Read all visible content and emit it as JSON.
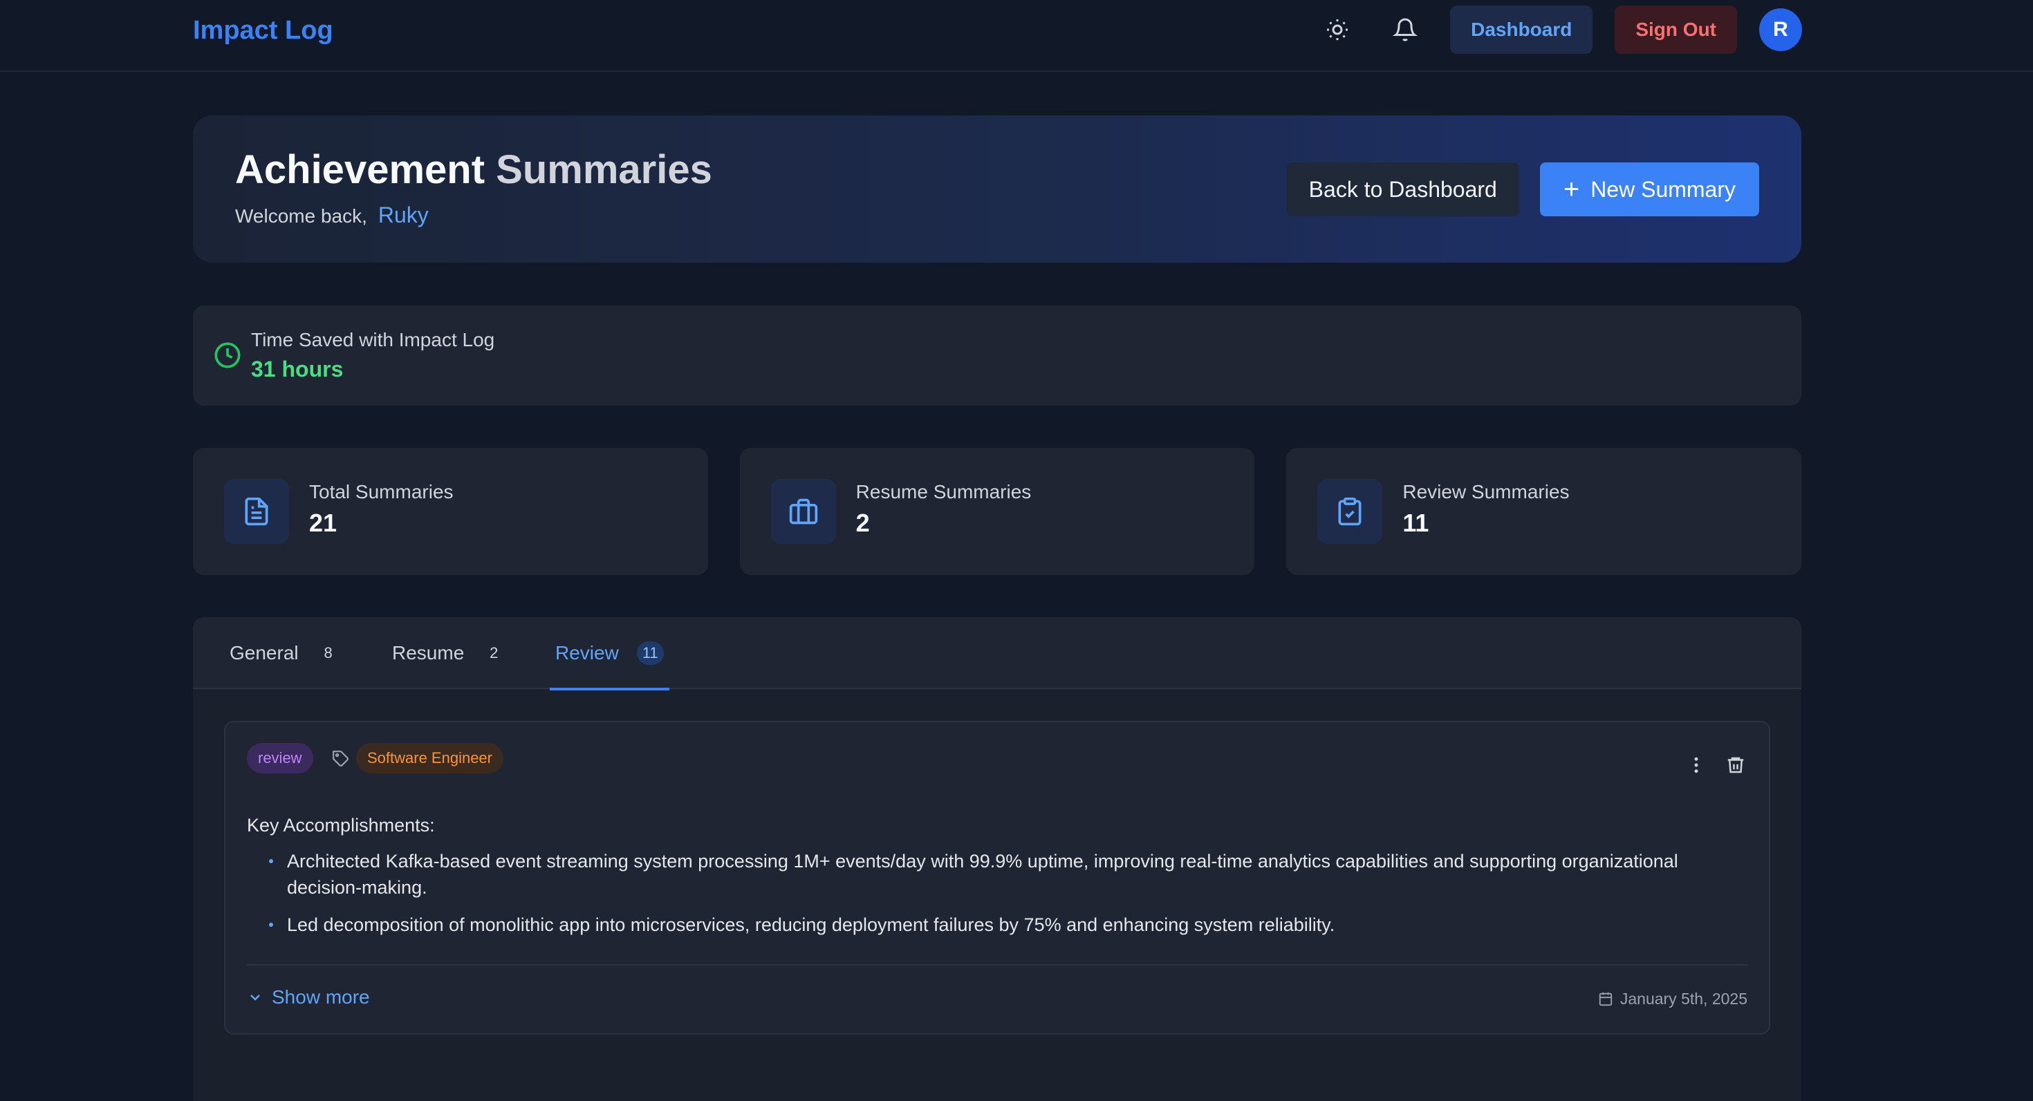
{
  "nav": {
    "brand": "Impact Log",
    "theme_icon": "sun-icon",
    "notification_icon": "bell-icon",
    "dashboard_label": "Dashboard",
    "signout_label": "Sign Out",
    "avatar_initial": "R"
  },
  "hero": {
    "title_word1": "Achievement",
    "title_word2": "Summaries",
    "welcome_prefix": "Welcome back,",
    "username": "Ruky",
    "back_label": "Back to Dashboard",
    "new_label": "New Summary"
  },
  "time_saved": {
    "label": "Time Saved with Impact Log",
    "value": "31 hours"
  },
  "stats": [
    {
      "label": "Total Summaries",
      "value": "21",
      "icon": "document-icon"
    },
    {
      "label": "Resume Summaries",
      "value": "2",
      "icon": "briefcase-icon"
    },
    {
      "label": "Review Summaries",
      "value": "11",
      "icon": "clipboard-check-icon"
    }
  ],
  "tabs": [
    {
      "label": "General",
      "count": "8"
    },
    {
      "label": "Resume",
      "count": "2"
    },
    {
      "label": "Review",
      "count": "11",
      "active": true
    }
  ],
  "summary_card": {
    "type_chip": "review",
    "role_chip": "Software Engineer",
    "heading": "Key Accomplishments:",
    "bullets": [
      "Architected Kafka-based event streaming system processing 1M+ events/day with 99.9% uptime, improving real-time analytics capabilities and supporting organizational decision-making.",
      "Led decomposition of monolithic app into microservices, reducing deployment failures by 75% and enhancing system reliability."
    ],
    "show_more_label": "Show more",
    "date": "January 5th, 2025"
  },
  "colors": {
    "accent": "#3b82f6",
    "success": "#4ade80",
    "danger": "#f87171",
    "background": "#111827"
  }
}
